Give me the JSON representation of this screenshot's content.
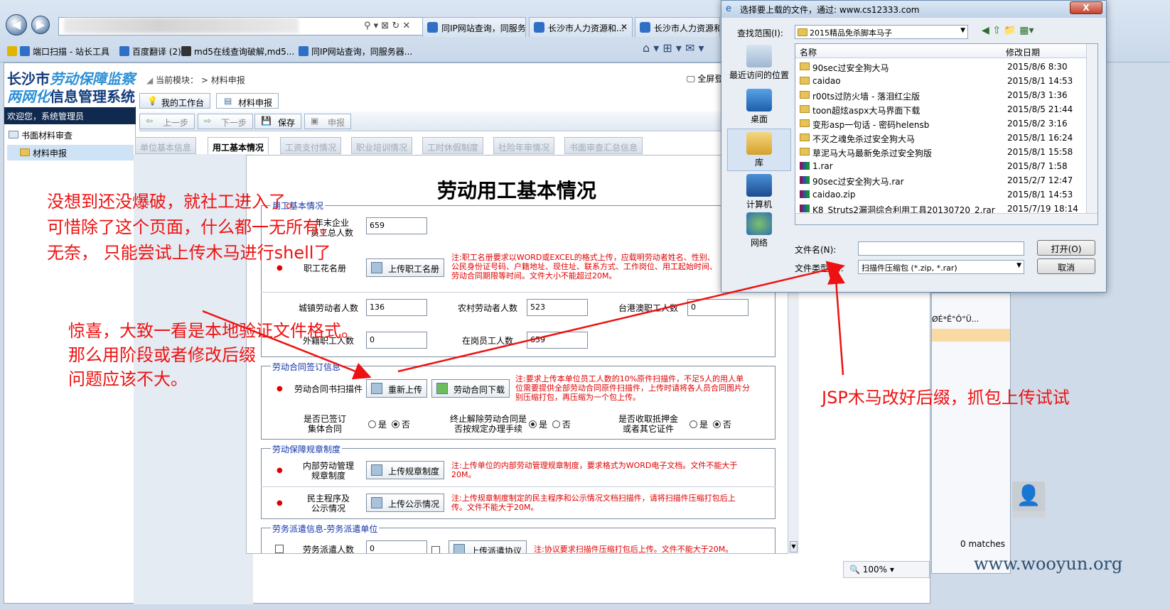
{
  "browser": {
    "tabs": [
      "同IP网站查询，同服务...",
      "长沙市人力资源和...",
      "长沙市人力资源和社"
    ],
    "favorites": [
      "端口扫描 - 站长工具",
      "百度翻译 (2)",
      "md5在线查询破解,md5...",
      "同IP网站查询，同服务器..."
    ]
  },
  "app": {
    "logo_line1_a": "长沙市",
    "logo_line1_b": "劳动保障监察",
    "logo_line2_a": "两网化",
    "logo_line2_b": "信息管理系统",
    "breadcrumb": "当前模块： > 材料申报",
    "fullscreen_label": "全屏登录",
    "welcome": "欢迎您，系统管理员",
    "sidebar": {
      "parent": "书面材料审查",
      "child": "材料申报"
    },
    "work_tabs": [
      "我的工作台",
      "材料申报"
    ],
    "toolbar": {
      "prev": "上一步",
      "next": "下一步",
      "save": "保存",
      "submit": "申报"
    },
    "form_tabs": [
      "单位基本信息",
      "用工基本情况",
      "工资支付情况",
      "职业培训情况",
      "工时休假制度",
      "社险年审情况",
      "书面审查汇总信息"
    ]
  },
  "form": {
    "title": "劳动用工基本情况",
    "sec1": {
      "legend": "用工基本情况",
      "annual_label": "年末企业\n员工总人数",
      "annual_value": "659",
      "roster_label": "职工花名册",
      "roster_btn": "上传职工名册",
      "roster_note": "注:职工名册要求以WORD或EXCEL的格式上传，应载明劳动者姓名、性别、公民身份证号码、户籍地址、现住址、联系方式、工作岗位、用工起始时间、劳动合同期限等时间。文件大小不能超过20M。",
      "urban_label": "城镇劳动者人数",
      "urban_value": "136",
      "rural_label": "农村劳动者人数",
      "rural_value": "523",
      "hkmt_label": "台港澳职工人数",
      "hkmt_value": "0",
      "foreign_label": "外籍职工人数",
      "foreign_value": "0",
      "onpost_label": "在岗员工人数",
      "onpost_value": "659"
    },
    "sec2": {
      "legend": "劳动合同签订信息",
      "contract_label": "劳动合同书扫描件",
      "reupload_btn": "重新上传",
      "download_btn": "劳动合同下载",
      "contract_note": "注:要求上传本单位员工人数的10%原件扫描件，不足5人的用人单位需要提供全部劳动合同原件扫描件，上传时请将各人员合同图片分别压缩打包，再压缩为一个包上传。",
      "q1": "是否已签订\n集体合同",
      "q2": "终止解除劳动合同是\n否按规定办理手续",
      "q3": "是否收取抵押金\n或者其它证件",
      "yes": "是",
      "no": "否"
    },
    "sec3": {
      "legend": "劳动保障规章制度",
      "rules_label": "内部劳动管理\n规章制度",
      "rules_btn": "上传规章制度",
      "rules_note": "注:上传单位的内部劳动管理规章制度，要求格式为WORD电子文档。文件不能大于20M。",
      "demo_label": "民主程序及\n公示情况",
      "demo_btn": "上传公示情况",
      "demo_note": "注:上传规章制度制定的民主程序和公示情况文档扫描件，请将扫描件压缩打包后上传。文件不能大于20M。"
    },
    "sec4": {
      "legend": "劳务派遣信息-劳务派遣单位",
      "dispatch_label": "劳务派遣人数",
      "dispatch_value": "0",
      "dispatch_btn": "上传派遣协议",
      "dispatch_note": "注:协议要求扫描件压缩打包后上传。文件不能大于20M。"
    }
  },
  "dialog": {
    "title": "选择要上载的文件，通过: www.cs12333.com",
    "close": "X",
    "lookin_label": "查找范围(I):",
    "lookin_value": "2015精品免杀脚本马子",
    "places": [
      "最近访问的位置",
      "桌面",
      "库",
      "计算机",
      "网络"
    ],
    "col_name": "名称",
    "col_date": "修改日期",
    "files": [
      {
        "name": "90sec过安全狗大马",
        "date": "2015/8/6 8:30",
        "type": "folder"
      },
      {
        "name": "caidao",
        "date": "2015/8/1 14:53",
        "type": "folder"
      },
      {
        "name": "r00ts过防火墙 - 落泪红尘版",
        "date": "2015/8/3 1:36",
        "type": "folder"
      },
      {
        "name": "toon超炫aspx大马界面下载",
        "date": "2015/8/5 21:44",
        "type": "folder"
      },
      {
        "name": "变形asp一句话 - 密码helensb",
        "date": "2015/8/2 3:16",
        "type": "folder"
      },
      {
        "name": "不灭之魂免杀过安全狗大马",
        "date": "2015/8/1 16:24",
        "type": "folder"
      },
      {
        "name": "草泥马大马最新免杀过安全狗版",
        "date": "2015/8/1 15:58",
        "type": "folder"
      },
      {
        "name": "1.rar",
        "date": "2015/8/7 1:58",
        "type": "rar"
      },
      {
        "name": "90sec过安全狗大马.rar",
        "date": "2015/2/7 12:47",
        "type": "rar"
      },
      {
        "name": "caidao.zip",
        "date": "2015/8/1 14:53",
        "type": "rar"
      },
      {
        "name": "K8_Struts2漏洞综合利用工具20130720_2.rar",
        "date": "2015/7/19 18:14",
        "type": "rar"
      }
    ],
    "filename_label": "文件名(N):",
    "filename_value": "",
    "filetype_label": "文件类型(T):",
    "filetype_value": "扫描件压缩包 (*.zip, *.rar)",
    "open_btn": "打开(O)",
    "cancel_btn": "取消"
  },
  "annotations": {
    "a1": "没想到还没爆破，就社工进入了。",
    "a2": "可惜除了这个页面，什么都一无所有。",
    "a3": "无奈， 只能尝试上传木马进行shell了",
    "b1": "惊喜，大致一看是本地验证文件格式。",
    "b2": "那么用阶段或者修改后缀",
    "b3": "问题应该不大。",
    "c1": "JSP木马改好后缀，抓包上传试试"
  },
  "misc": {
    "zoom": "100%",
    "matches": "0 matches",
    "watermark": "www.wooyun.org",
    "garbled": "ØÉ*Ê°Ô°Ü..."
  }
}
